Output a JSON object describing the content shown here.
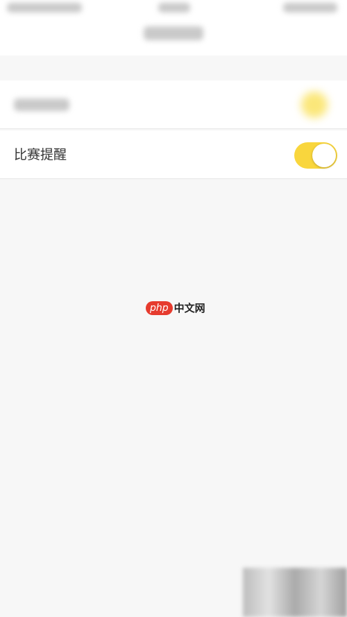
{
  "settings": {
    "rows": [
      {
        "label": "",
        "enabled": true
      },
      {
        "label": "比赛提醒",
        "enabled": true
      }
    ]
  },
  "watermark": {
    "brand": "php",
    "suffix": "中文网"
  },
  "colors": {
    "toggle_on": "#f9d63d",
    "background": "#f7f7f7",
    "row_background": "#ffffff"
  }
}
